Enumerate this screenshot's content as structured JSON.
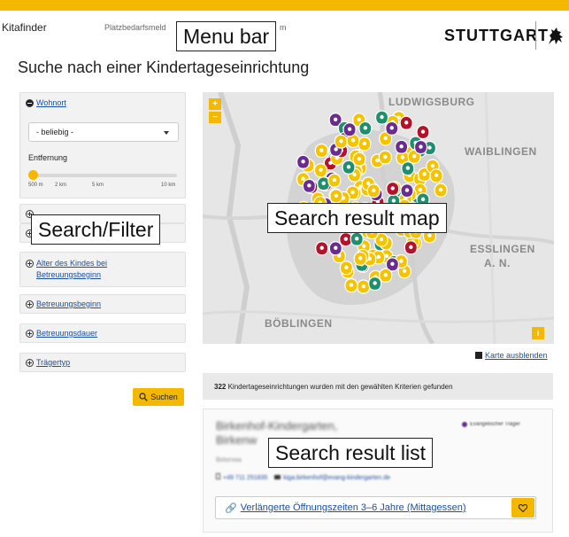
{
  "header": {
    "brand": "Kitafinder",
    "menu_item_1": "Platzbedarfsmeld",
    "menu_item_2": "m",
    "city_logo_text": "STUTTGART",
    "annotation_menu": "Menu bar"
  },
  "page": {
    "title": "Suche nach einer Kindertageseinrichtung"
  },
  "filters": {
    "annotation": "Search/Filter",
    "residence": {
      "label": "Wohnort",
      "select_value": "- beliebig -",
      "distance_label": "Entfernung",
      "distance_ticks": [
        "500 m",
        "2 km",
        "5 km",
        "10 km"
      ],
      "distance_selected_fraction": 0
    },
    "child_age": {
      "label_line1": "Alter des Kindes bei",
      "label_line2": "Betreuungsbeginn"
    },
    "care_start": {
      "label": "Betreuungsbeginn"
    },
    "care_duration": {
      "label": "Betreuungsdauer"
    },
    "provider_type": {
      "label": "Trägertyp"
    },
    "search_button": "Suchen"
  },
  "map": {
    "annotation": "Search result map",
    "places": [
      "LUDWIGSBURG",
      "WAIBLINGEN",
      "ESSLINGEN",
      "A. N.",
      "BÖBLINGEN"
    ],
    "zoom_in": "+",
    "zoom_out": "−",
    "info": "i",
    "hide_link": "Karte ausblenden",
    "marker_colors": {
      "municipal": "#f5c400",
      "protestant": "#6a2c8f",
      "catholic": "#b3122a",
      "other": "#1f8f6e"
    }
  },
  "results": {
    "count": "322",
    "summary": "Kindertageseinrichtungen wurden mit den gewählten Kriterien gefunden",
    "annotation": "Search result list",
    "first": {
      "name_line1": "Birkenhof-Kindergarten,",
      "name_line2": "Birkenw",
      "address": "Birkenwa",
      "phone": "+49 711 251835",
      "email": "kiga.birkenhof@evang-kindergarten.de",
      "provider_badge": "Evangelischer Träger",
      "opening_hours": "Verlängerte Öffnungszeiten 3–6 Jahre (Mittagessen)"
    }
  },
  "colors": {
    "accent": "#f5b800",
    "link": "#1a4f9c"
  }
}
